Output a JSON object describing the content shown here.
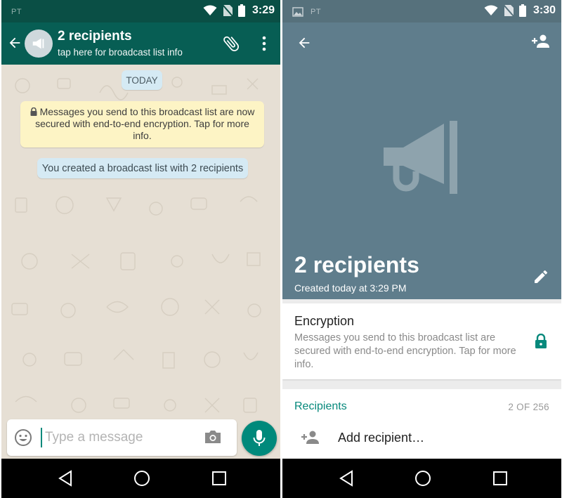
{
  "left_screen": {
    "status_bar": {
      "carrier": "PT",
      "time": "3:29"
    },
    "header": {
      "title": "2 recipients",
      "subtitle": "tap here for broadcast list info",
      "icons": [
        "back-arrow-icon",
        "megaphone-avatar-icon",
        "paperclip-icon",
        "more-vertical-icon"
      ]
    },
    "chat": {
      "date_chip": "TODAY",
      "encryption_notice": "Messages you send to this broadcast list are now secured with end-to-end encryption. Tap for more info.",
      "system_message": "You created a broadcast list with 2 recipients"
    },
    "composer": {
      "placeholder": "Type a message",
      "value": "",
      "icons": [
        "emoji-icon",
        "camera-icon",
        "mic-icon"
      ]
    }
  },
  "right_screen": {
    "status_bar": {
      "carrier": "PT",
      "time": "3:30"
    },
    "header": {
      "title": "2 recipients",
      "subtitle": "Created today at 3:29 PM",
      "icons": [
        "back-arrow-icon",
        "add-person-icon",
        "megaphone-icon",
        "edit-icon"
      ]
    },
    "encryption": {
      "title": "Encryption",
      "description": "Messages you send to this broadcast list are secured with end-to-end encryption. Tap for more info."
    },
    "recipients": {
      "title": "Recipients",
      "count": "2 OF 256",
      "add_label": "Add recipient…"
    }
  },
  "colors": {
    "whatsapp_teal_dark": "#075e54",
    "status_bar_dark": "#0a4f45",
    "accent_teal": "#00897b",
    "info_header": "#5f7d8c",
    "chat_background": "#e6dfd4",
    "encryption_bubble": "#fdf4c5",
    "system_bubble": "#d5eaf4"
  }
}
